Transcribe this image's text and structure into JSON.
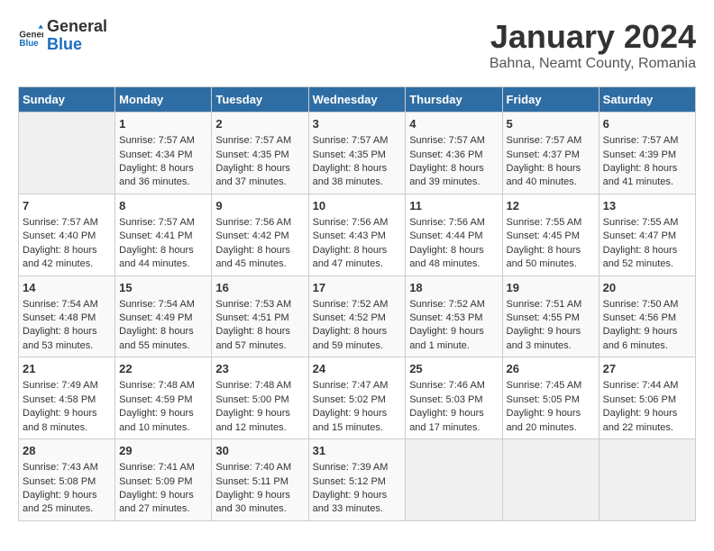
{
  "header": {
    "logo_general": "General",
    "logo_blue": "Blue",
    "title": "January 2024",
    "subtitle": "Bahna, Neamt County, Romania"
  },
  "days_of_week": [
    "Sunday",
    "Monday",
    "Tuesday",
    "Wednesday",
    "Thursday",
    "Friday",
    "Saturday"
  ],
  "weeks": [
    [
      {
        "day": "",
        "content": ""
      },
      {
        "day": "1",
        "content": "Sunrise: 7:57 AM\nSunset: 4:34 PM\nDaylight: 8 hours\nand 36 minutes."
      },
      {
        "day": "2",
        "content": "Sunrise: 7:57 AM\nSunset: 4:35 PM\nDaylight: 8 hours\nand 37 minutes."
      },
      {
        "day": "3",
        "content": "Sunrise: 7:57 AM\nSunset: 4:35 PM\nDaylight: 8 hours\nand 38 minutes."
      },
      {
        "day": "4",
        "content": "Sunrise: 7:57 AM\nSunset: 4:36 PM\nDaylight: 8 hours\nand 39 minutes."
      },
      {
        "day": "5",
        "content": "Sunrise: 7:57 AM\nSunset: 4:37 PM\nDaylight: 8 hours\nand 40 minutes."
      },
      {
        "day": "6",
        "content": "Sunrise: 7:57 AM\nSunset: 4:39 PM\nDaylight: 8 hours\nand 41 minutes."
      }
    ],
    [
      {
        "day": "7",
        "content": "Sunrise: 7:57 AM\nSunset: 4:40 PM\nDaylight: 8 hours\nand 42 minutes."
      },
      {
        "day": "8",
        "content": "Sunrise: 7:57 AM\nSunset: 4:41 PM\nDaylight: 8 hours\nand 44 minutes."
      },
      {
        "day": "9",
        "content": "Sunrise: 7:56 AM\nSunset: 4:42 PM\nDaylight: 8 hours\nand 45 minutes."
      },
      {
        "day": "10",
        "content": "Sunrise: 7:56 AM\nSunset: 4:43 PM\nDaylight: 8 hours\nand 47 minutes."
      },
      {
        "day": "11",
        "content": "Sunrise: 7:56 AM\nSunset: 4:44 PM\nDaylight: 8 hours\nand 48 minutes."
      },
      {
        "day": "12",
        "content": "Sunrise: 7:55 AM\nSunset: 4:45 PM\nDaylight: 8 hours\nand 50 minutes."
      },
      {
        "day": "13",
        "content": "Sunrise: 7:55 AM\nSunset: 4:47 PM\nDaylight: 8 hours\nand 52 minutes."
      }
    ],
    [
      {
        "day": "14",
        "content": "Sunrise: 7:54 AM\nSunset: 4:48 PM\nDaylight: 8 hours\nand 53 minutes."
      },
      {
        "day": "15",
        "content": "Sunrise: 7:54 AM\nSunset: 4:49 PM\nDaylight: 8 hours\nand 55 minutes."
      },
      {
        "day": "16",
        "content": "Sunrise: 7:53 AM\nSunset: 4:51 PM\nDaylight: 8 hours\nand 57 minutes."
      },
      {
        "day": "17",
        "content": "Sunrise: 7:52 AM\nSunset: 4:52 PM\nDaylight: 8 hours\nand 59 minutes."
      },
      {
        "day": "18",
        "content": "Sunrise: 7:52 AM\nSunset: 4:53 PM\nDaylight: 9 hours\nand 1 minute."
      },
      {
        "day": "19",
        "content": "Sunrise: 7:51 AM\nSunset: 4:55 PM\nDaylight: 9 hours\nand 3 minutes."
      },
      {
        "day": "20",
        "content": "Sunrise: 7:50 AM\nSunset: 4:56 PM\nDaylight: 9 hours\nand 6 minutes."
      }
    ],
    [
      {
        "day": "21",
        "content": "Sunrise: 7:49 AM\nSunset: 4:58 PM\nDaylight: 9 hours\nand 8 minutes."
      },
      {
        "day": "22",
        "content": "Sunrise: 7:48 AM\nSunset: 4:59 PM\nDaylight: 9 hours\nand 10 minutes."
      },
      {
        "day": "23",
        "content": "Sunrise: 7:48 AM\nSunset: 5:00 PM\nDaylight: 9 hours\nand 12 minutes."
      },
      {
        "day": "24",
        "content": "Sunrise: 7:47 AM\nSunset: 5:02 PM\nDaylight: 9 hours\nand 15 minutes."
      },
      {
        "day": "25",
        "content": "Sunrise: 7:46 AM\nSunset: 5:03 PM\nDaylight: 9 hours\nand 17 minutes."
      },
      {
        "day": "26",
        "content": "Sunrise: 7:45 AM\nSunset: 5:05 PM\nDaylight: 9 hours\nand 20 minutes."
      },
      {
        "day": "27",
        "content": "Sunrise: 7:44 AM\nSunset: 5:06 PM\nDaylight: 9 hours\nand 22 minutes."
      }
    ],
    [
      {
        "day": "28",
        "content": "Sunrise: 7:43 AM\nSunset: 5:08 PM\nDaylight: 9 hours\nand 25 minutes."
      },
      {
        "day": "29",
        "content": "Sunrise: 7:41 AM\nSunset: 5:09 PM\nDaylight: 9 hours\nand 27 minutes."
      },
      {
        "day": "30",
        "content": "Sunrise: 7:40 AM\nSunset: 5:11 PM\nDaylight: 9 hours\nand 30 minutes."
      },
      {
        "day": "31",
        "content": "Sunrise: 7:39 AM\nSunset: 5:12 PM\nDaylight: 9 hours\nand 33 minutes."
      },
      {
        "day": "",
        "content": ""
      },
      {
        "day": "",
        "content": ""
      },
      {
        "day": "",
        "content": ""
      }
    ]
  ]
}
